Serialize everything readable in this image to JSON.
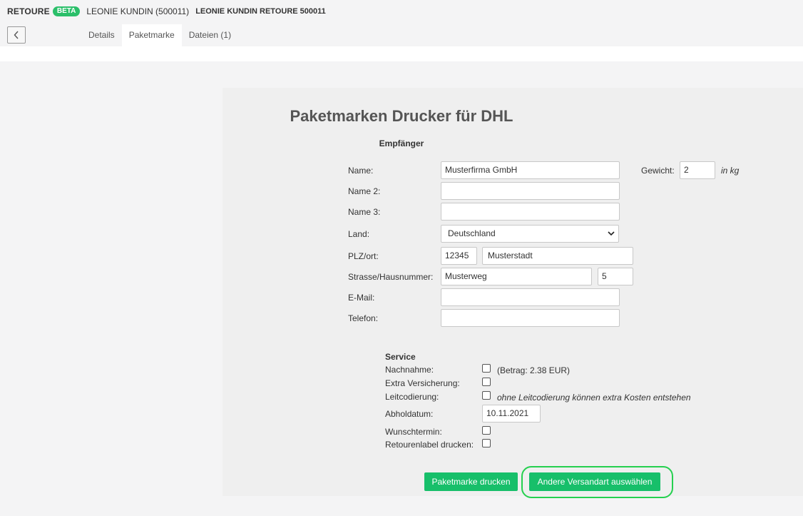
{
  "header": {
    "brand": "RETOURE",
    "badge": "BETA",
    "customer": "LEONIE KUNDIN (500011)",
    "reference": "LEONIE KUNDIN RETOURE 500011"
  },
  "tabs": [
    {
      "label": "Details",
      "active": false
    },
    {
      "label": "Paketmarke",
      "active": true
    },
    {
      "label": "Dateien (1)",
      "active": false
    }
  ],
  "form": {
    "title": "Paketmarken Drucker für DHL",
    "section": "Empfänger",
    "name_label": "Name:",
    "name_value": "Musterfirma GmbH",
    "name2_label": "Name 2:",
    "name2_value": "",
    "name3_label": "Name 3:",
    "name3_value": "",
    "country_label": "Land:",
    "country_value": "Deutschland",
    "zip_label": "PLZ/ort:",
    "zip_value": "12345",
    "city_value": "Musterstadt",
    "street_label": "Strasse/Hausnummer:",
    "street_value": "Musterweg",
    "house_value": "5",
    "email_label": "E-Mail:",
    "email_value": "",
    "phone_label": "Telefon:",
    "phone_value": "",
    "weight_label": "Gewicht:",
    "weight_value": "2",
    "weight_unit": "in kg"
  },
  "service": {
    "title": "Service",
    "cod_label": "Nachnahme:",
    "cod_amount": "(Betrag: 2.38 EUR)",
    "cod_checked": false,
    "insurance_label": "Extra Versicherung:",
    "insurance_checked": false,
    "routing_label": "Leitcodierung:",
    "routing_note": "ohne Leitcodierung können extra Kosten entstehen",
    "routing_checked": false,
    "pickup_label": "Abholdatum:",
    "pickup_value": "10.11.2021",
    "appointment_label": "Wunschtermin:",
    "appointment_checked": false,
    "return_label": "Retourenlabel drucken:",
    "return_checked": false
  },
  "buttons": {
    "print": "Paketmarke drucken",
    "other": "Andere Versandart auswählen"
  },
  "colors": {
    "accent": "#17bf6a",
    "badge": "#2bbf6a",
    "highlight": "#25d04f"
  }
}
